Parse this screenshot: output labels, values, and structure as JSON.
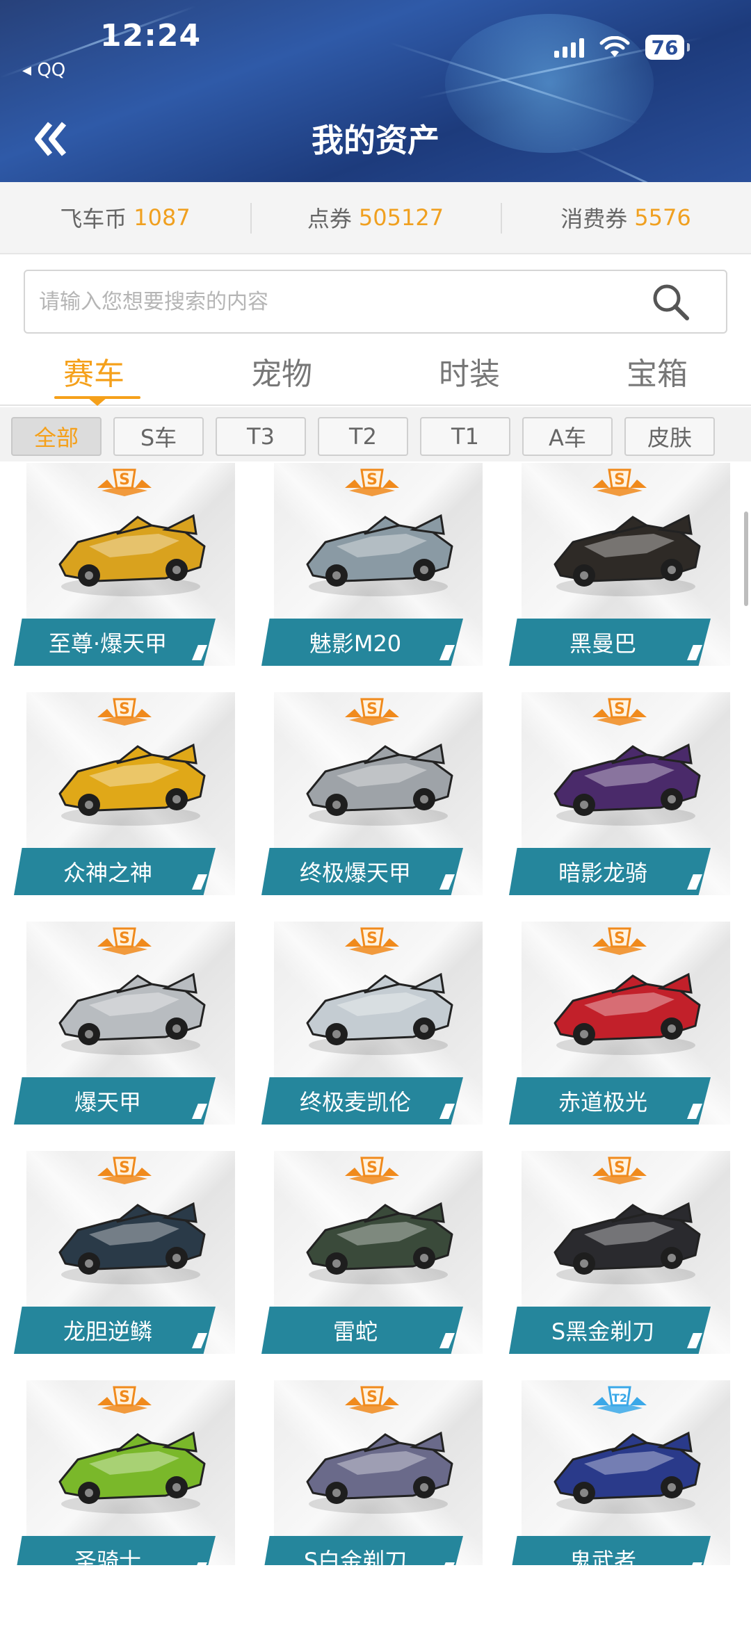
{
  "status_bar": {
    "time": "12:24",
    "back_app": "◂ QQ",
    "battery": "76"
  },
  "header": {
    "title": "我的资产"
  },
  "currencies": [
    {
      "name": "飞车币",
      "value": "1087"
    },
    {
      "name": "点券",
      "value": "505127"
    },
    {
      "name": "消费券",
      "value": "5576"
    }
  ],
  "search": {
    "placeholder": "请输入您想要搜索的内容"
  },
  "tabs": [
    {
      "label": "赛车",
      "active": true
    },
    {
      "label": "宠物",
      "active": false
    },
    {
      "label": "时装",
      "active": false
    },
    {
      "label": "宝箱",
      "active": false
    }
  ],
  "filters": [
    {
      "label": "全部",
      "active": true
    },
    {
      "label": "S车",
      "active": false
    },
    {
      "label": "T3",
      "active": false
    },
    {
      "label": "T2",
      "active": false
    },
    {
      "label": "T1",
      "active": false
    },
    {
      "label": "A车",
      "active": false
    },
    {
      "label": "皮肤",
      "active": false
    }
  ],
  "cars": [
    {
      "name": "至尊·爆天甲",
      "badge": "S",
      "color": "#d9a21e"
    },
    {
      "name": "魅影M20",
      "badge": "S",
      "color": "#8a9aa4"
    },
    {
      "name": "黑曼巴",
      "badge": "S",
      "color": "#2e2a26"
    },
    {
      "name": "众神之神",
      "badge": "S",
      "color": "#e0a818"
    },
    {
      "name": "终极爆天甲",
      "badge": "S",
      "color": "#9ea3a8"
    },
    {
      "name": "暗影龙骑",
      "badge": "S",
      "color": "#4a2a6a"
    },
    {
      "name": "爆天甲",
      "badge": "S",
      "color": "#b8bcc0"
    },
    {
      "name": "终极麦凯伦",
      "badge": "S",
      "color": "#c4ccd2"
    },
    {
      "name": "赤道极光",
      "badge": "S",
      "color": "#c2202a"
    },
    {
      "name": "龙胆逆鳞",
      "badge": "S",
      "color": "#2a3a48"
    },
    {
      "name": "雷蛇",
      "badge": "S",
      "color": "#3a4a3a"
    },
    {
      "name": "S黑金剃刀",
      "badge": "S",
      "color": "#2a2a2e"
    },
    {
      "name": "圣骑士",
      "badge": "S",
      "color": "#7ab82a"
    },
    {
      "name": "S白金剃刀",
      "badge": "S",
      "color": "#6a6a8a"
    },
    {
      "name": "鬼武者",
      "badge": "T2",
      "color": "#2a3a8a"
    }
  ],
  "colors": {
    "accent": "#f5a01a",
    "label_bg": "#25869c",
    "currency_value": "#f0a020"
  }
}
